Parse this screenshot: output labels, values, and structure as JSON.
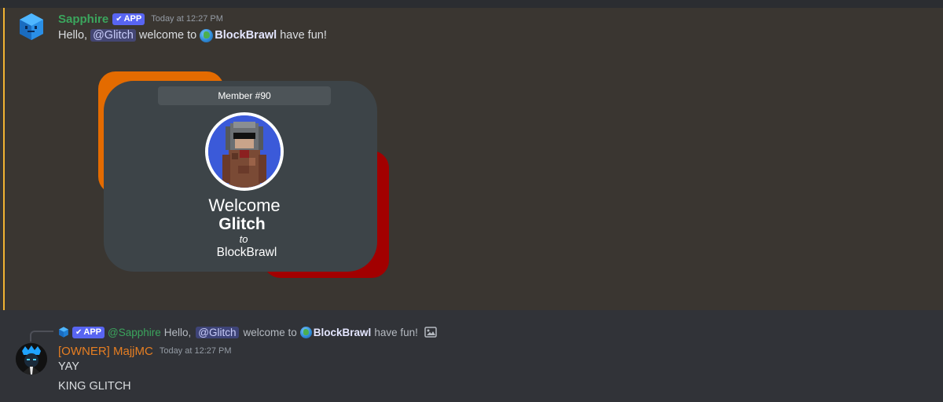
{
  "colors": {
    "background": "#313338",
    "highlight_background": "#3a3631",
    "highlight_bar": "#f0b232",
    "bot_name": "#3ba55d",
    "owner_name": "#e67e22",
    "app_badge": "#5865f2",
    "card_orange": "#e46b00",
    "card_red": "#a20000",
    "card_body": "#3d4448"
  },
  "message1": {
    "avatar_icon": "sapphire-cube-icon",
    "username": "Sapphire",
    "badge": "APP",
    "timestamp": "Today at 12:27 PM",
    "text_before": "Hello,",
    "mention": "@Glitch",
    "text_mid": "welcome to",
    "channel_icon": "globe-icon",
    "channel": "BlockBrawl",
    "text_after": "have fun!"
  },
  "card": {
    "member_label": "Member #90",
    "avatar_icon": "minecraft-skin-avatar",
    "welcome": "Welcome",
    "name": "Glitch",
    "to": "to",
    "server": "BlockBrawl"
  },
  "message2": {
    "reply": {
      "avatar_icon": "sapphire-cube-icon",
      "badge": "APP",
      "username": "@Sapphire",
      "text_before": "Hello,",
      "mention": "@Glitch",
      "text_mid": "welcome to",
      "channel": "BlockBrawl",
      "text_after": "have fun!",
      "attachment_icon": "image-icon"
    },
    "avatar_icon": "crowned-avatar",
    "username": "[OWNER] MajjMC",
    "timestamp": "Today at 12:27 PM",
    "lines": [
      "YAY",
      "KING GLITCH"
    ]
  }
}
